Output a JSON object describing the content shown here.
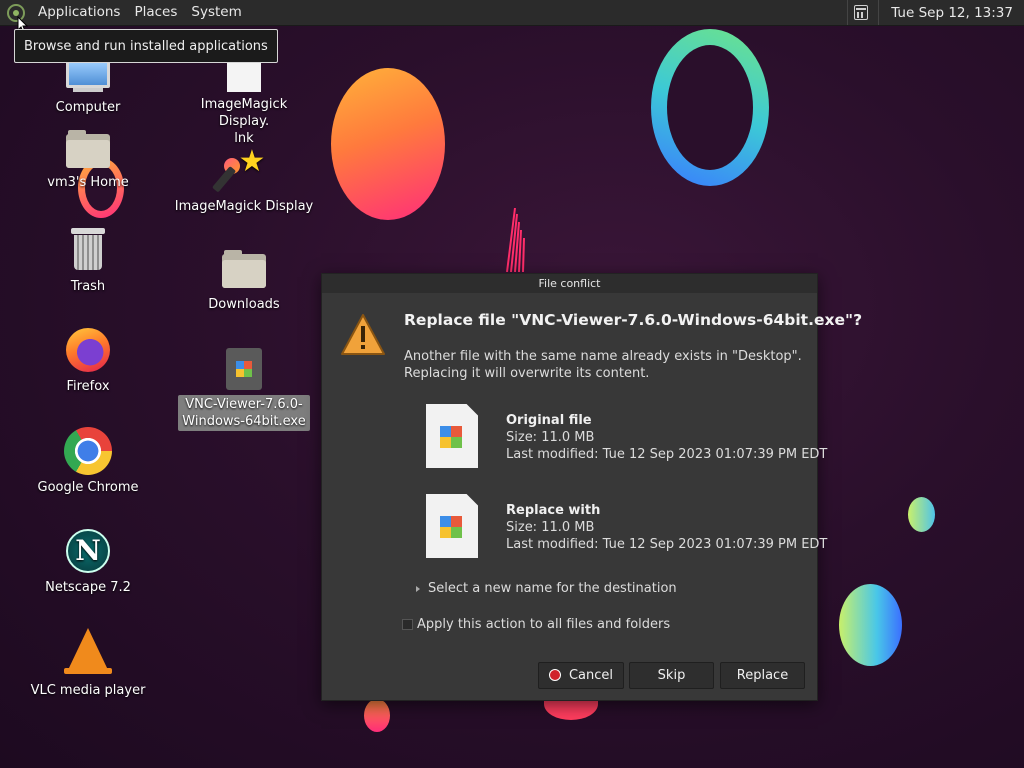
{
  "panel": {
    "menus": [
      "Applications",
      "Places",
      "System"
    ],
    "clock": "Tue Sep 12, 13:37"
  },
  "tooltip": "Browse and run installed applications",
  "desktop": {
    "icons": [
      {
        "label": "Computer",
        "icon": "computer-icon"
      },
      {
        "label": "vm3's Home",
        "icon": "home-folder-icon"
      },
      {
        "label": "Trash",
        "icon": "trash-icon"
      },
      {
        "label": "Firefox",
        "icon": "firefox-icon"
      },
      {
        "label": "Google Chrome",
        "icon": "chrome-icon"
      },
      {
        "label": "Netscape 7.2",
        "icon": "netscape-icon"
      },
      {
        "label": "VLC media player",
        "icon": "vlc-icon"
      },
      {
        "label": "ImageMagick Display.\nlnk",
        "icon": "file-icon"
      },
      {
        "label": "ImageMagick Display",
        "icon": "imagemagick-icon"
      },
      {
        "label": "Downloads",
        "icon": "folder-icon"
      },
      {
        "label": "VNC-Viewer-7.6.0-\nWindows-64bit.exe",
        "icon": "exe-file-icon"
      }
    ],
    "netscape_glyph": "N"
  },
  "dialog": {
    "title": "File conflict",
    "heading": "Replace file \"VNC-Viewer-7.6.0-Windows-64bit.exe\"?",
    "message_line1": "Another file with the same name already exists in \"Desktop\".",
    "message_line2": "Replacing it will overwrite its content.",
    "original": {
      "title": "Original file",
      "size": "Size: 11.0 MB",
      "modified": "Last modified: Tue 12 Sep 2023 01:07:39 PM EDT"
    },
    "replacement": {
      "title": "Replace with",
      "size": "Size: 11.0 MB",
      "modified": "Last modified: Tue 12 Sep 2023 01:07:39 PM EDT"
    },
    "rename_expander": "Select a new name for the destination",
    "apply_all": "Apply this action to all files and folders",
    "apply_all_checked": false,
    "buttons": {
      "cancel": "Cancel",
      "skip": "Skip",
      "replace": "Replace"
    }
  },
  "colors": {
    "background": "#2a0f2b",
    "dialog_bg": "#383838",
    "panel_bg": "#2b2b2b",
    "cancel_accent": "#d0212b"
  }
}
